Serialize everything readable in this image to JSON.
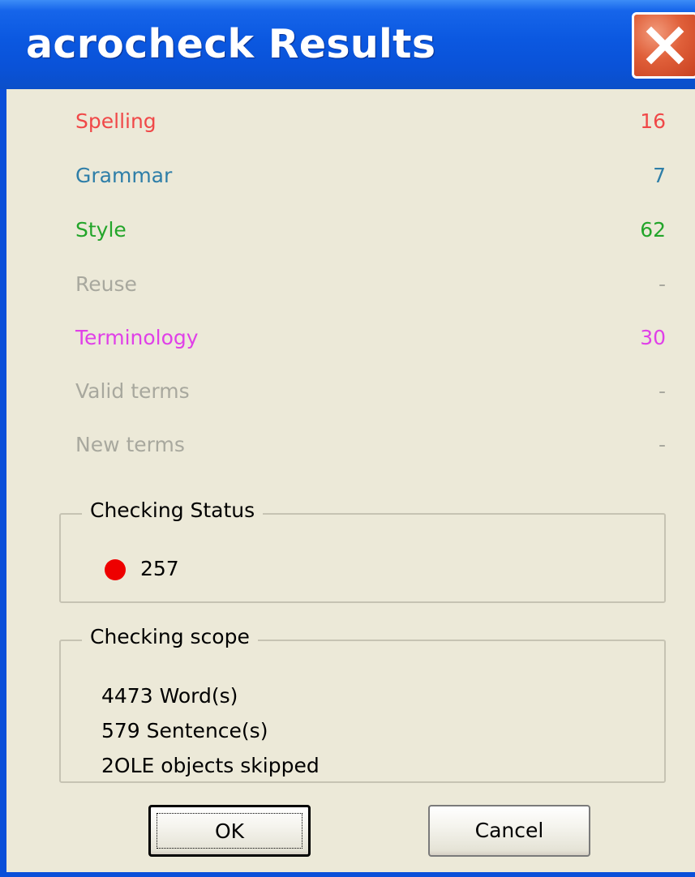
{
  "window": {
    "title": "acrocheck Results",
    "close_icon": "close-x-icon"
  },
  "results": [
    {
      "label": "Spelling",
      "value": "16",
      "color": "#f04848"
    },
    {
      "label": "Grammar",
      "value": "7",
      "color": "#2e7ea8"
    },
    {
      "label": "Style",
      "value": "62",
      "color": "#23a52a"
    },
    {
      "label": "Reuse",
      "value": "-",
      "color": "#a8a89e"
    },
    {
      "label": "Terminology",
      "value": "30",
      "color": "#e040e8"
    },
    {
      "label": "Valid terms",
      "value": "-",
      "color": "#a8a89e"
    },
    {
      "label": "New terms",
      "value": "-",
      "color": "#a8a89e"
    }
  ],
  "checking_status": {
    "legend": "Checking Status",
    "indicator_color": "#ee0000",
    "value": "257"
  },
  "checking_scope": {
    "legend": "Checking scope",
    "lines": [
      "4473 Word(s)",
      "579 Sentence(s)",
      "2OLE objects skipped"
    ]
  },
  "buttons": {
    "ok": "OK",
    "cancel": "Cancel"
  }
}
